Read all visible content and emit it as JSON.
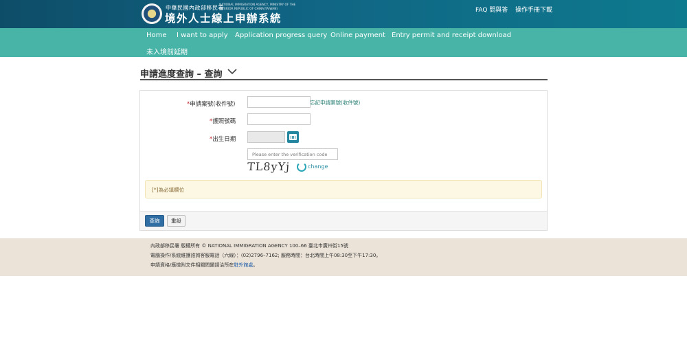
{
  "header": {
    "agency_zh": "中華民國內政部移民署",
    "agency_en": "NATIONAL IMMIGRATION AGENCY, MINISTRY OF THE INTERIOR REPUBLIC OF CHINA(TAIWAN)",
    "system_title": "境外人士線上申辦系統",
    "links": {
      "faq": "FAQ 問與答",
      "manual": "操作手冊下載"
    }
  },
  "nav": {
    "home": "Home",
    "apply": "I want to apply",
    "progress": "Application progress query",
    "payment": "Online payment",
    "download": "Entry permit and receipt download",
    "extension": "未入境前延期"
  },
  "page": {
    "title": "申請進度查詢 – 查詢"
  },
  "form": {
    "required_mark": "*",
    "case_no_label": "申請案號(收件號)",
    "case_no_value": "",
    "forgot_link": "忘記申請案號(收件號)",
    "passport_label": "護照號碼",
    "passport_value": "",
    "birth_label": "出生日期",
    "birth_value": "",
    "captcha_placeholder": "Please enter the verification code",
    "captcha_text": "TL8yYj",
    "change_label": "change",
    "required_note": "[*]為必填欄位",
    "submit_label": "查詢",
    "reset_label": "重設"
  },
  "footer": {
    "line1": "內政部移民署 版權所有 © NATIONAL IMMIGRATION AGENCY 100–66 臺北市廣州街15號",
    "line2": "電腦操作/系統維護諮詢客服電話（六線）：(02)2796–7162; 服務時間：台北時間上午08:30至下午17:30。",
    "line3_prefix": "申請資格/應檢附文件相關問題請洽所在",
    "line3_link": "駐外館處",
    "line3_suffix": "。"
  },
  "colors": {
    "header_bg": "#106584",
    "nav_bg": "#48b4a8",
    "primary_button": "#2f6da3",
    "required": "#c0282e",
    "notice_bg": "#fcf8e3",
    "footer_bg": "#ebe3d8"
  }
}
